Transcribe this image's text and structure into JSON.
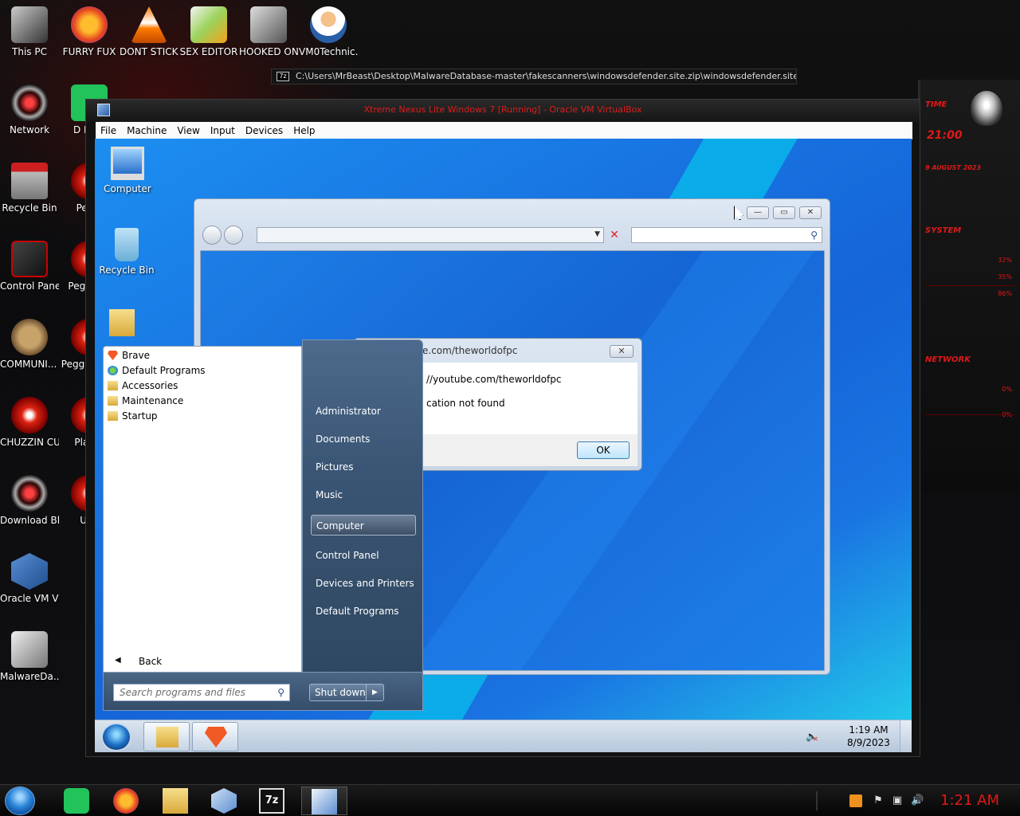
{
  "host_desktop": {
    "icons": [
      {
        "label": "This PC",
        "icon": "computer-icon"
      },
      {
        "label": "FURRY FUX",
        "icon": "firefox-icon"
      },
      {
        "label": "DONT STICK THIS IN YO...",
        "icon": "vlc-cone-icon"
      },
      {
        "label": "SEX EDITOR",
        "icon": "hxd-icon"
      },
      {
        "label": "HOOKED ON XONI...",
        "icon": "app-icon"
      },
      {
        "label": "VM0Technic...",
        "icon": "doctor-icon"
      },
      {
        "label": "Network",
        "icon": "network-icon"
      },
      {
        "label": "D DUN",
        "icon": "green-app-icon"
      },
      {
        "label": "Recycle Bin",
        "icon": "recycle-bin-icon"
      },
      {
        "label": "Peggl",
        "icon": "peggle-icon"
      },
      {
        "label": "Control Panel",
        "icon": "control-panel-icon"
      },
      {
        "label": "Peggl De",
        "icon": "peggle-icon"
      },
      {
        "label": "COMMUNI... HATE THIS ...",
        "icon": "money-bag-icon"
      },
      {
        "label": "Peggl of Wa",
        "icon": "peggle-icon"
      },
      {
        "label": "CHUZZIN CUM",
        "icon": "chuzzle-icon"
      },
      {
        "label": "Pla Zo",
        "icon": "game-icon"
      },
      {
        "label": "Download Black Ali...",
        "icon": "alien-icon"
      },
      {
        "label": "UKF",
        "icon": "game-icon"
      },
      {
        "label": "Oracle VM VirtualBox",
        "icon": "virtualbox-icon"
      },
      {
        "label": "MalwareDa...",
        "icon": "archive-icon"
      }
    ],
    "address_strip": {
      "badge": "7z",
      "path": "C:\\Users\\MrBeast\\Desktop\\MalwareDatabase-master\\fakescanners\\windowsdefender.site.zip\\windowsdefender.site\\download\\"
    },
    "gadget": {
      "time": "21:00",
      "date": "9 AUGUST 2023",
      "labels": [
        "TIME",
        "SYSTEM",
        "NETWORK"
      ],
      "percents": [
        "32%",
        "35%",
        "86%",
        "0%",
        "0%"
      ]
    }
  },
  "vbox": {
    "title": "Xtreme Nexus Lite Windows 7 [Running] - Oracle VM VirtualBox",
    "menu": [
      "File",
      "Machine",
      "View",
      "Input",
      "Devices",
      "Help"
    ]
  },
  "guest": {
    "desktop_icons": [
      {
        "label": "Computer",
        "icon": "computer-icon"
      },
      {
        "label": "Recycle Bin",
        "icon": "recycle-bin-icon"
      },
      {
        "label": "",
        "icon": "folder-icon"
      }
    ],
    "explorer": {
      "address_value": "",
      "search_value": ""
    },
    "msgbox": {
      "title": "e.com/theworldofpc",
      "line1": "//youtube.com/theworldofpc",
      "line2": "cation not found",
      "ok_label": "OK",
      "close_glyph": "✕"
    },
    "start_menu": {
      "programs": [
        {
          "label": "Brave",
          "icon": "brave-icon"
        },
        {
          "label": "Default Programs",
          "icon": "default-programs-icon"
        },
        {
          "label": "Accessories",
          "icon": "folder-icon"
        },
        {
          "label": "Maintenance",
          "icon": "folder-icon"
        },
        {
          "label": "Startup",
          "icon": "folder-icon"
        }
      ],
      "back_label": "Back",
      "places": [
        {
          "label": "Administrator"
        },
        {
          "label": "Documents"
        },
        {
          "label": "Pictures"
        },
        {
          "label": "Music"
        },
        {
          "label": "Computer",
          "highlighted": true
        },
        {
          "label": "Control Panel"
        },
        {
          "label": "Devices and Printers"
        },
        {
          "label": "Default Programs"
        }
      ],
      "search_placeholder": "Search programs and files",
      "shutdown_label": "Shut down"
    },
    "taskbar": {
      "pinned": [
        "explorer-folder-icon",
        "brave-icon"
      ],
      "time": "1:19 AM",
      "date": "8/9/2023"
    }
  },
  "host_taskbar": {
    "pinned": [
      "notes-icon",
      "firefox-icon",
      "file-explorer-icon",
      "virtualbox-icon",
      "7zip-icon",
      "virtualbox-win7-icon"
    ],
    "seven_zip_label": "7z",
    "clock": "1:21 AM"
  }
}
